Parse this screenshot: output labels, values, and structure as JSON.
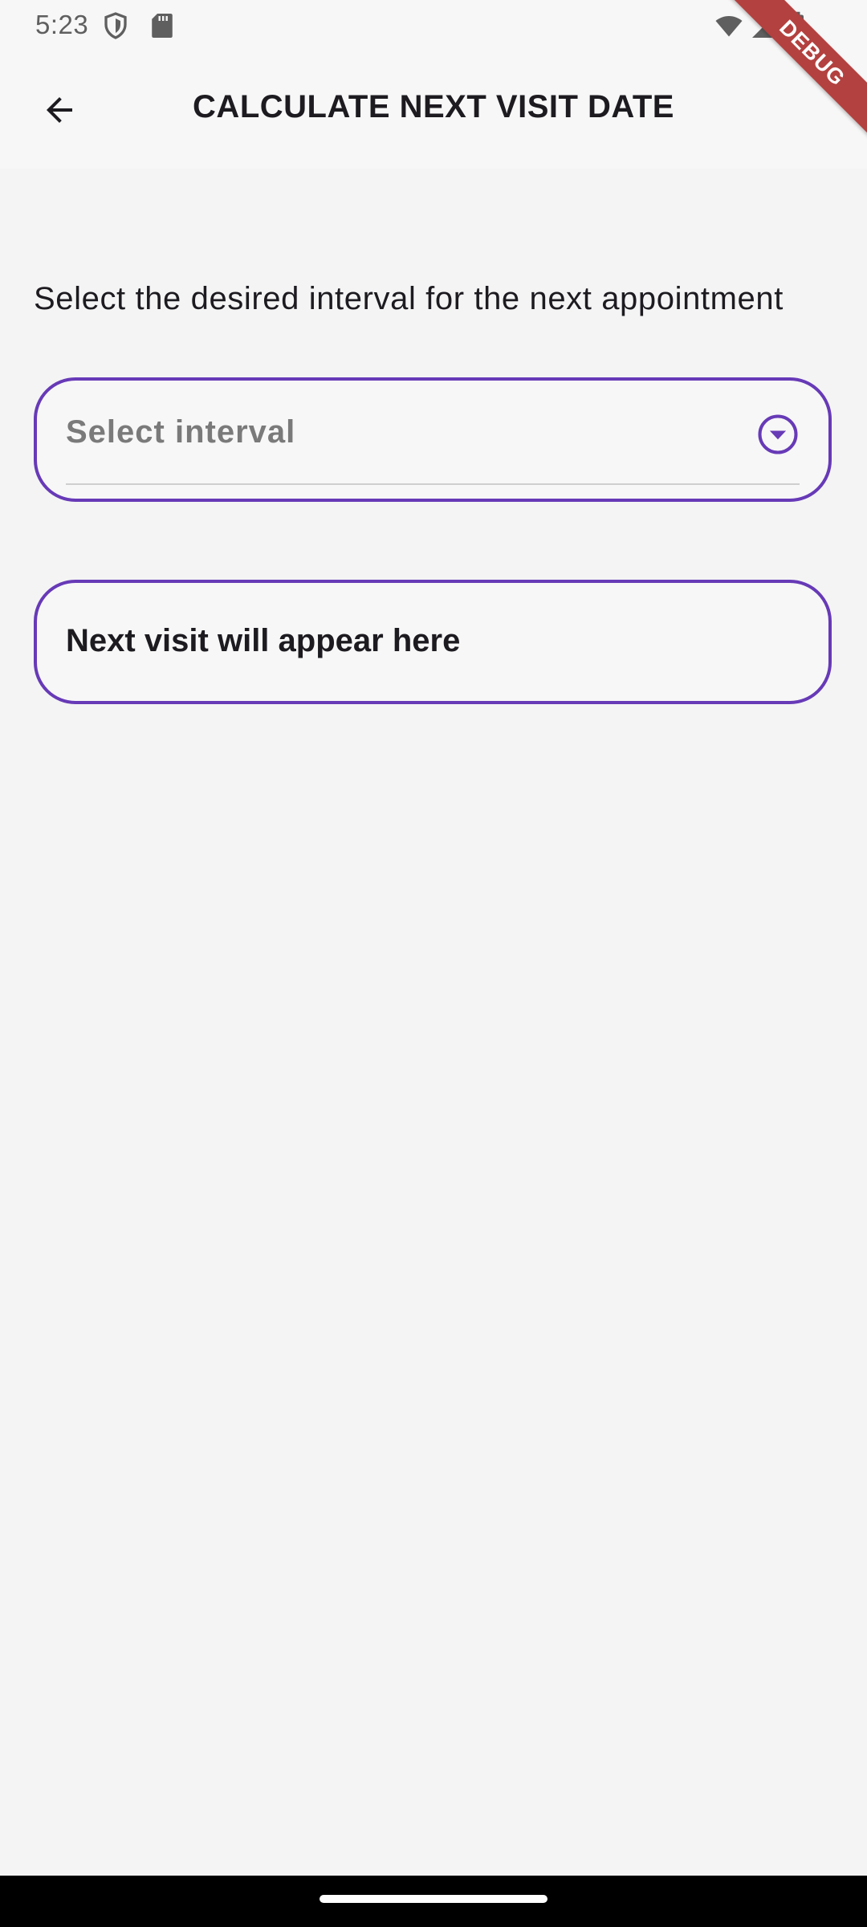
{
  "status_bar": {
    "time": "5:23",
    "icons": [
      "shield-icon",
      "sd-card-icon",
      "wifi-icon",
      "cell-signal-icon",
      "battery-icon"
    ]
  },
  "app_bar": {
    "title": "CALCULATE NEXT VISIT DATE",
    "back_icon": "arrow-back-icon"
  },
  "debug_banner": {
    "label": "DEBUG",
    "color": "#b3413f"
  },
  "main": {
    "instruction": "Select the desired interval for the next appointment",
    "interval_select": {
      "placeholder": "Select interval",
      "value": "",
      "icon": "dropdown-circle-icon"
    },
    "result": {
      "text": "Next visit will appear here"
    }
  },
  "colors": {
    "accent": "#673ab7",
    "background": "#f4f4f4",
    "text": "#1d1b20"
  }
}
